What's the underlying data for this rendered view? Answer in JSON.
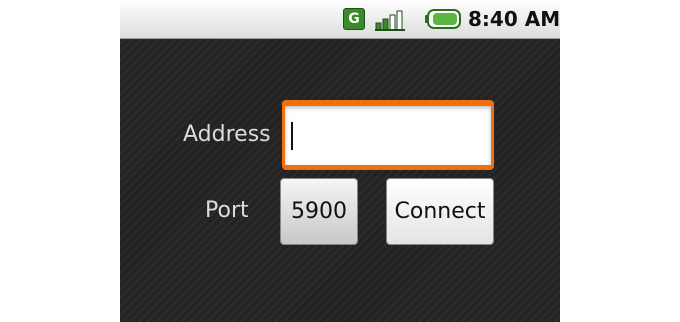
{
  "status_bar": {
    "network_icon": "network-g-icon",
    "network_label": "G",
    "signal_icon": "signal-strength-icon",
    "battery_icon": "battery-icon",
    "time": "8:40 AM"
  },
  "form": {
    "address_label": "Address",
    "address_value": "",
    "port_label": "Port",
    "port_value": "5900",
    "connect_label": "Connect"
  },
  "colors": {
    "focus_accent": "#f07010",
    "background": "#232323",
    "network_icon": "#3a8a2a"
  }
}
